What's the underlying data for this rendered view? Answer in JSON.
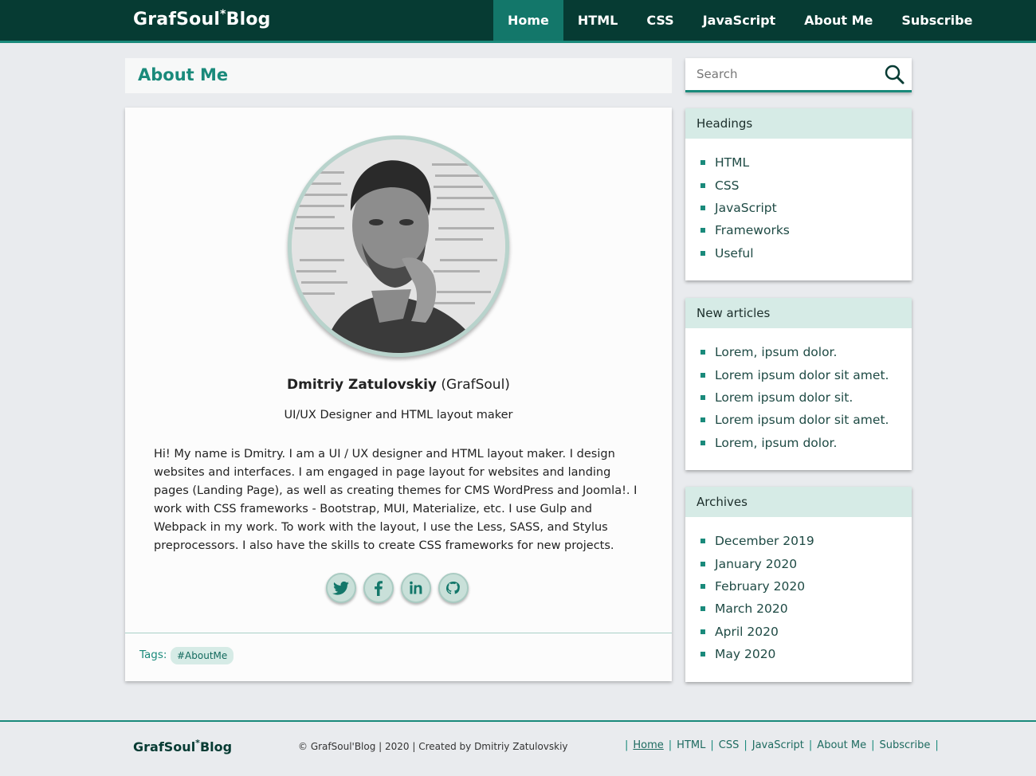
{
  "header": {
    "logo_main": "GrafSoul",
    "logo_mark": "*",
    "logo_tail": "Blog",
    "nav": [
      {
        "label": "Home",
        "active": true
      },
      {
        "label": "HTML"
      },
      {
        "label": "CSS"
      },
      {
        "label": "JavaScript"
      },
      {
        "label": "About Me"
      },
      {
        "label": "Subscribe"
      }
    ]
  },
  "page": {
    "title": "About Me"
  },
  "profile": {
    "name": "Dmitriy Zatulovskiy",
    "alias": "(GrafSoul)",
    "role": "UI/UX Designer and HTML layout maker",
    "bio": "Hi! My name is Dmitry. I am a UI / UX designer and HTML layout maker. I design websites and interfaces. I am engaged in page layout for websites and landing pages (Landing Page), as well as creating themes for CMS WordPress and Joomla!. I work with CSS frameworks - Bootstrap, MUI, Materialize, etc. I use Gulp and Webpack in my work. To work with the layout, I use the Less, SASS, and Stylus preprocessors. I also have the skills to create CSS frameworks for new projects.",
    "socials": [
      "twitter-icon",
      "facebook-icon",
      "linkedin-icon",
      "github-icon"
    ],
    "tags_label": "Tags:",
    "tags": [
      "#AboutMe"
    ]
  },
  "search": {
    "placeholder": "Search"
  },
  "sidebar": {
    "headings": {
      "title": "Headings",
      "items": [
        "HTML",
        "CSS",
        "JavaScript",
        "Frameworks",
        "Useful"
      ]
    },
    "new_articles": {
      "title": "New articles",
      "items": [
        "Lorem, ipsum dolor.",
        "Lorem ipsum dolor sit amet.",
        "Lorem ipsum dolor sit.",
        "Lorem ipsum dolor sit amet.",
        "Lorem, ipsum dolor."
      ]
    },
    "archives": {
      "title": "Archives",
      "items": [
        "December 2019",
        "January 2020",
        "February 2020",
        "March 2020",
        "April 2020",
        "May 2020"
      ]
    }
  },
  "footer": {
    "logo_main": "GrafSoul",
    "logo_mark": "*",
    "logo_tail": "Blog",
    "copyright": "© GrafSoul'Blog | 2020 | Created by Dmitriy Zatulovskiy",
    "nav": [
      {
        "label": "Home",
        "active": true
      },
      {
        "label": "HTML"
      },
      {
        "label": "CSS"
      },
      {
        "label": "JavaScript"
      },
      {
        "label": "About Me"
      },
      {
        "label": "Subscribe"
      }
    ]
  },
  "colors": {
    "header_bg": "#063b33",
    "accent": "#1a8a7b",
    "nav_active": "#13776a",
    "widget_head": "#d6ebe6",
    "page_bg": "#e9ebee"
  }
}
